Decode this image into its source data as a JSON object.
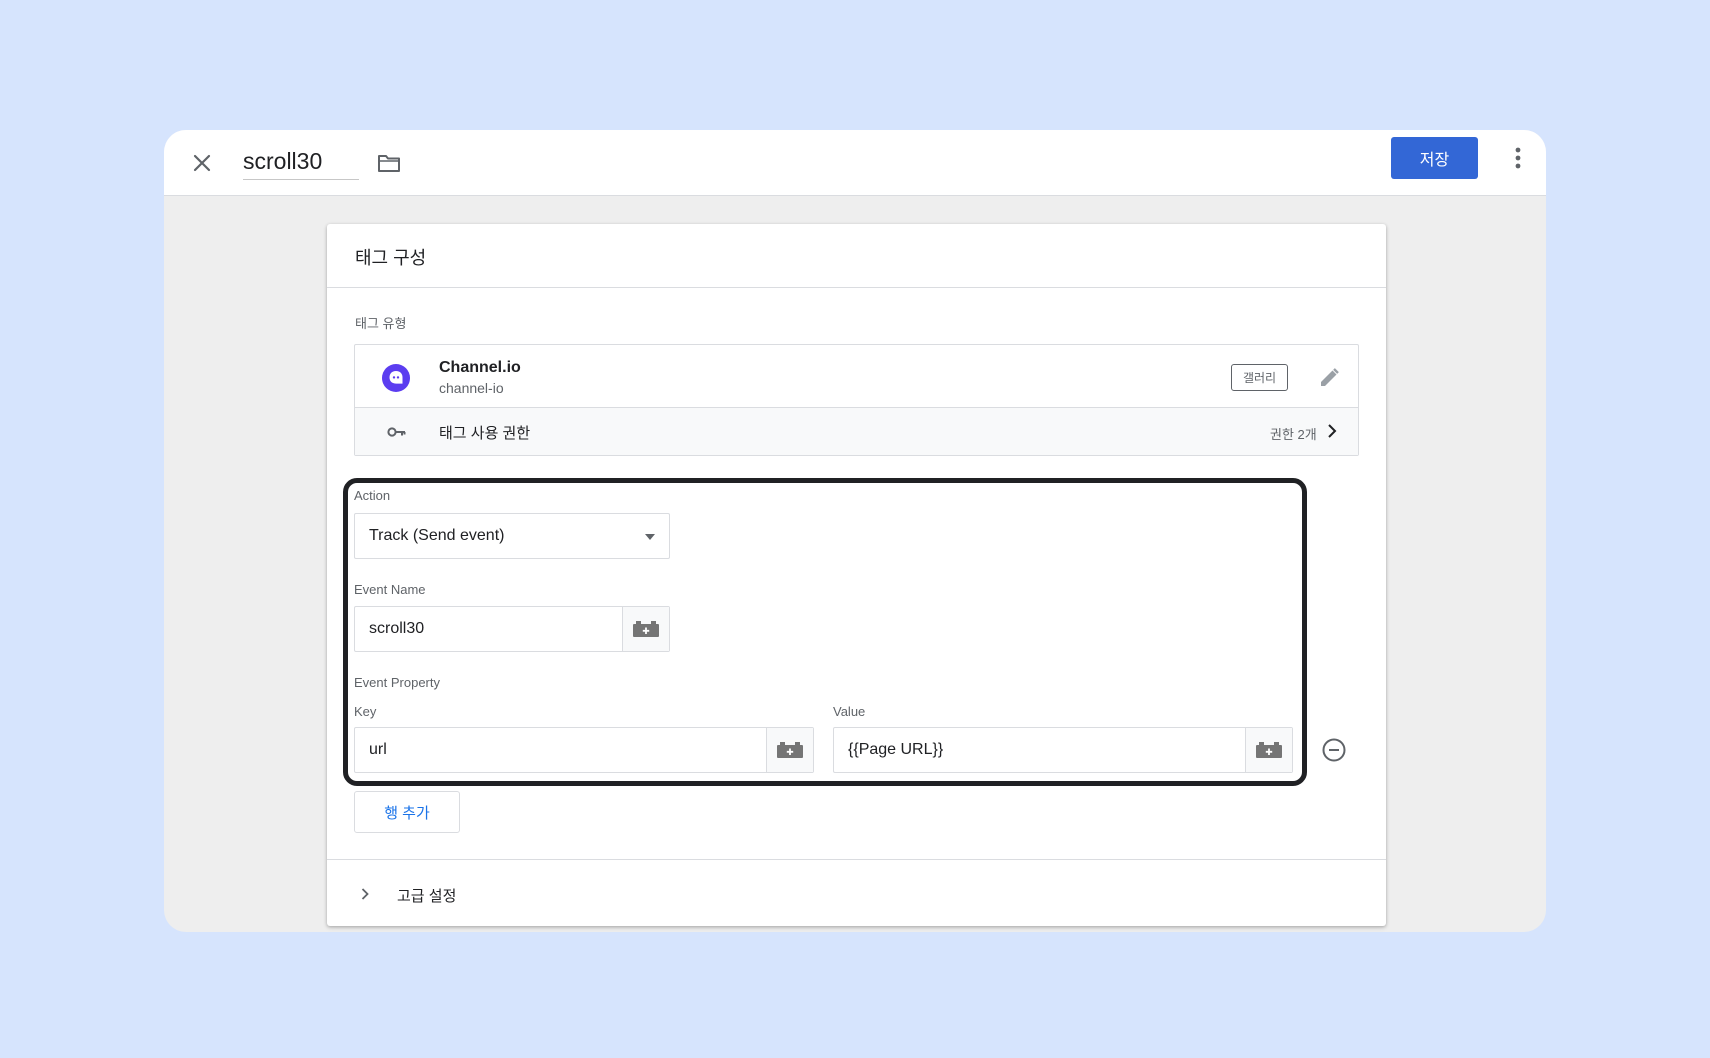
{
  "header": {
    "tag_name": "scroll30",
    "save_label": "저장"
  },
  "card": {
    "title": "태그 구성",
    "tag_type_label": "태그 유형",
    "tag_type": {
      "name": "Channel.io",
      "id": "channel-io",
      "badge": "갤러리"
    },
    "permissions": {
      "label": "태그 사용 권한",
      "count": "권한 2개"
    }
  },
  "form": {
    "action_label": "Action",
    "action_value": "Track (Send event)",
    "event_name_label": "Event Name",
    "event_name_value": "scroll30",
    "event_property_label": "Event Property",
    "key_label": "Key",
    "key_value": "url",
    "value_label": "Value",
    "value_value": "{{Page URL}}",
    "add_row_label": "행 추가"
  },
  "advanced": {
    "label": "고급 설정"
  },
  "colors": {
    "background": "#d6e4fd",
    "primary": "#3367d6",
    "channel_brand": "#5b3df0",
    "link": "#1a73e8"
  }
}
